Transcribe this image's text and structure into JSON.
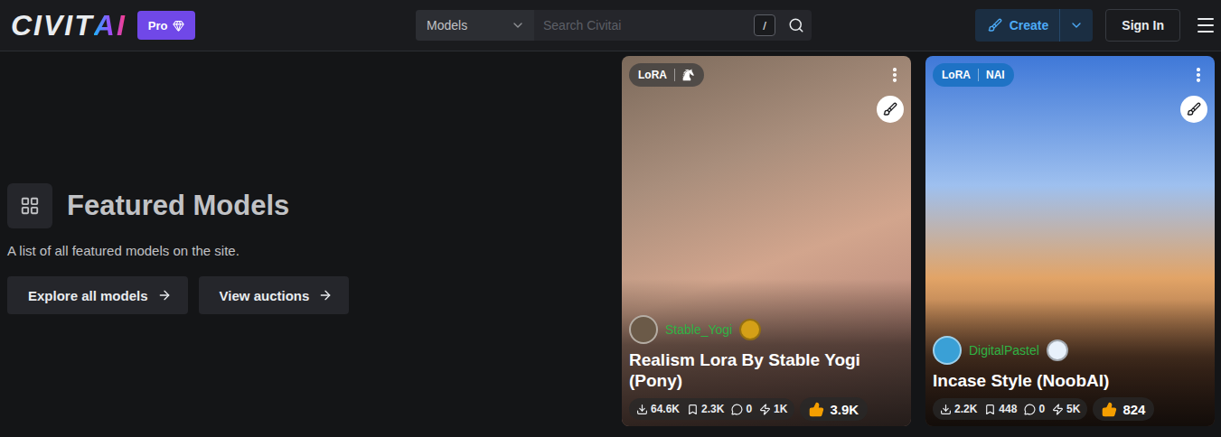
{
  "header": {
    "logo": [
      "CIVIT",
      "AI"
    ],
    "pro_badge": "Pro",
    "search": {
      "category": "Models",
      "placeholder": "Search Civitai",
      "shortcut": "/"
    },
    "create_button": "Create",
    "sign_in_button": "Sign In"
  },
  "featured": {
    "title": "Featured Models",
    "description": "A list of all featured models on the site.",
    "buttons": [
      "Explore all models",
      "View auctions"
    ]
  },
  "cards": [
    {
      "type": "LoRA",
      "base": {
        "kind": "icon",
        "label": ""
      },
      "user": "Stable_Yogi",
      "badge_color": "#d4a017",
      "title": "Realism Lora By Stable Yogi (Pony)",
      "stats": [
        {
          "kind": "downloads",
          "value": "64.6K"
        },
        {
          "kind": "bookmarks",
          "value": "2.3K"
        },
        {
          "kind": "comments",
          "value": "0"
        },
        {
          "kind": "buzz",
          "value": "1K"
        }
      ],
      "likes": "3.9K"
    },
    {
      "type": "LoRA",
      "base": {
        "kind": "text",
        "label": "NAI"
      },
      "user": "DigitalPastel",
      "badge_color": "#e8f1fb",
      "title": "Incase Style (NoobAI)",
      "stats": [
        {
          "kind": "downloads",
          "value": "2.2K"
        },
        {
          "kind": "bookmarks",
          "value": "448"
        },
        {
          "kind": "comments",
          "value": "0"
        },
        {
          "kind": "buzz",
          "value": "5K"
        }
      ],
      "likes": "824"
    }
  ]
}
